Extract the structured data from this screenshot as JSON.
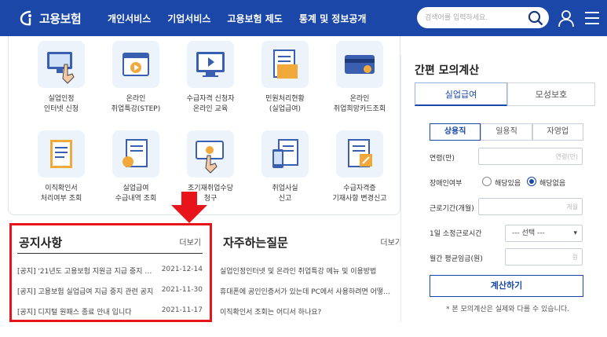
{
  "header": {
    "logo_text": "고용보험",
    "nav": [
      "개인서비스",
      "기업서비스",
      "고용보험 제도",
      "통계 및 정보공개"
    ],
    "search_placeholder": "검색어를 입력하세요."
  },
  "services": [
    {
      "label": "실업인정\n인터넷 신청",
      "icon": "computer-hand-icon"
    },
    {
      "label": "온라인\n취업특강(STEP)",
      "icon": "online-lecture-icon"
    },
    {
      "label": "수급자격 신청자\n온라인 교육",
      "icon": "video-monitor-icon"
    },
    {
      "label": "민원처리현황\n(실업급여)",
      "icon": "document-folder-icon"
    },
    {
      "label": "온라인\n취업희망카드조회",
      "icon": "card-icon"
    },
    {
      "label": "이직확인서\n처리여부 조회",
      "icon": "form-doc-icon"
    },
    {
      "label": "실업급여\n수급내역 조회",
      "icon": "money-doc-icon"
    },
    {
      "label": "조기재취업수당\n청구",
      "icon": "card-hand-icon"
    },
    {
      "label": "취업사실\n신고",
      "icon": "report-phone-icon"
    },
    {
      "label": "수급자격증\n기재사항 변경신고",
      "icon": "edit-doc-icon"
    }
  ],
  "notice": {
    "title": "공지사항",
    "more": "더보기",
    "items": [
      {
        "title": "[공지] '21년도 고용보험 지원금 지급 중지 …",
        "date": "2021-12-14"
      },
      {
        "title": "[공지] 고용보험 실업급여 지급 중지 관련 공지",
        "date": "2021-11-30"
      },
      {
        "title": "[공지] 디지털 원패스 종료 안내 입니다",
        "date": "2021-11-17"
      }
    ]
  },
  "faq": {
    "title": "자주하는질문",
    "more": "더보기",
    "items": [
      "실업인정인터넷 및 온라인 취업특강 메뉴 및 이용방법",
      "휴대폰에 공인인증서가 있는데 PC에서 사용하려면 어떻…",
      "이직확인서 조회는 어디서 하나요?"
    ]
  },
  "calculator": {
    "title": "간편 모의계산",
    "tabs": [
      "실업급여",
      "모성보호"
    ],
    "segments": [
      "상용직",
      "일용직",
      "자영업"
    ],
    "age_label": "연령(만)",
    "age_placeholder": "연령(만)",
    "disability_label": "장애인여부",
    "disability_yes": "해당있음",
    "disability_no": "해당없음",
    "period_label": "근로기간(개월)",
    "period_placeholder": "개월",
    "hours_label": "1일 소정근로시간",
    "hours_selected": "--- 선택 ---",
    "wage_label": "월간 평균임금(원)",
    "wage_placeholder": "원",
    "button": "계산하기",
    "note": "* 본 모의계산은 실제와 다를 수 있습니다."
  },
  "colors": {
    "header": "#1a47a8",
    "highlight": "#e8141c"
  }
}
